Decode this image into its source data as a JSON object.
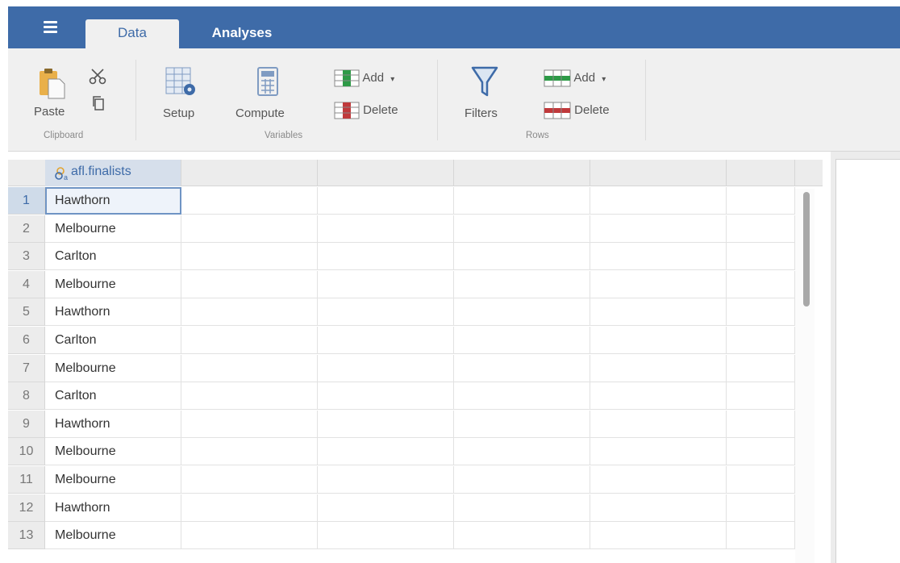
{
  "menu": {
    "icon": "hamburger-icon"
  },
  "tabs": [
    {
      "label": "Data",
      "active": true
    },
    {
      "label": "Analyses",
      "active": false
    }
  ],
  "ribbon": {
    "paste_label": "Paste",
    "clipboard_group": "Clipboard",
    "setup_label": "Setup",
    "compute_label": "Compute",
    "variables_group": "Variables",
    "var_add_label": "Add",
    "var_delete_label": "Delete",
    "filters_label": "Filters",
    "row_add_label": "Add",
    "row_delete_label": "Delete",
    "rows_group": "Rows"
  },
  "colors": {
    "brand": "#3e6ba8",
    "green": "#2e9a47",
    "red": "#c0393b"
  },
  "sheet": {
    "column": "afl.finalists",
    "rows": [
      {
        "n": "1",
        "value": "Hawthorn"
      },
      {
        "n": "2",
        "value": "Melbourne"
      },
      {
        "n": "3",
        "value": "Carlton"
      },
      {
        "n": "4",
        "value": "Melbourne"
      },
      {
        "n": "5",
        "value": "Hawthorn"
      },
      {
        "n": "6",
        "value": "Carlton"
      },
      {
        "n": "7",
        "value": "Melbourne"
      },
      {
        "n": "8",
        "value": "Carlton"
      },
      {
        "n": "9",
        "value": "Hawthorn"
      },
      {
        "n": "10",
        "value": "Melbourne"
      },
      {
        "n": "11",
        "value": "Melbourne"
      },
      {
        "n": "12",
        "value": "Hawthorn"
      },
      {
        "n": "13",
        "value": "Melbourne"
      }
    ]
  }
}
